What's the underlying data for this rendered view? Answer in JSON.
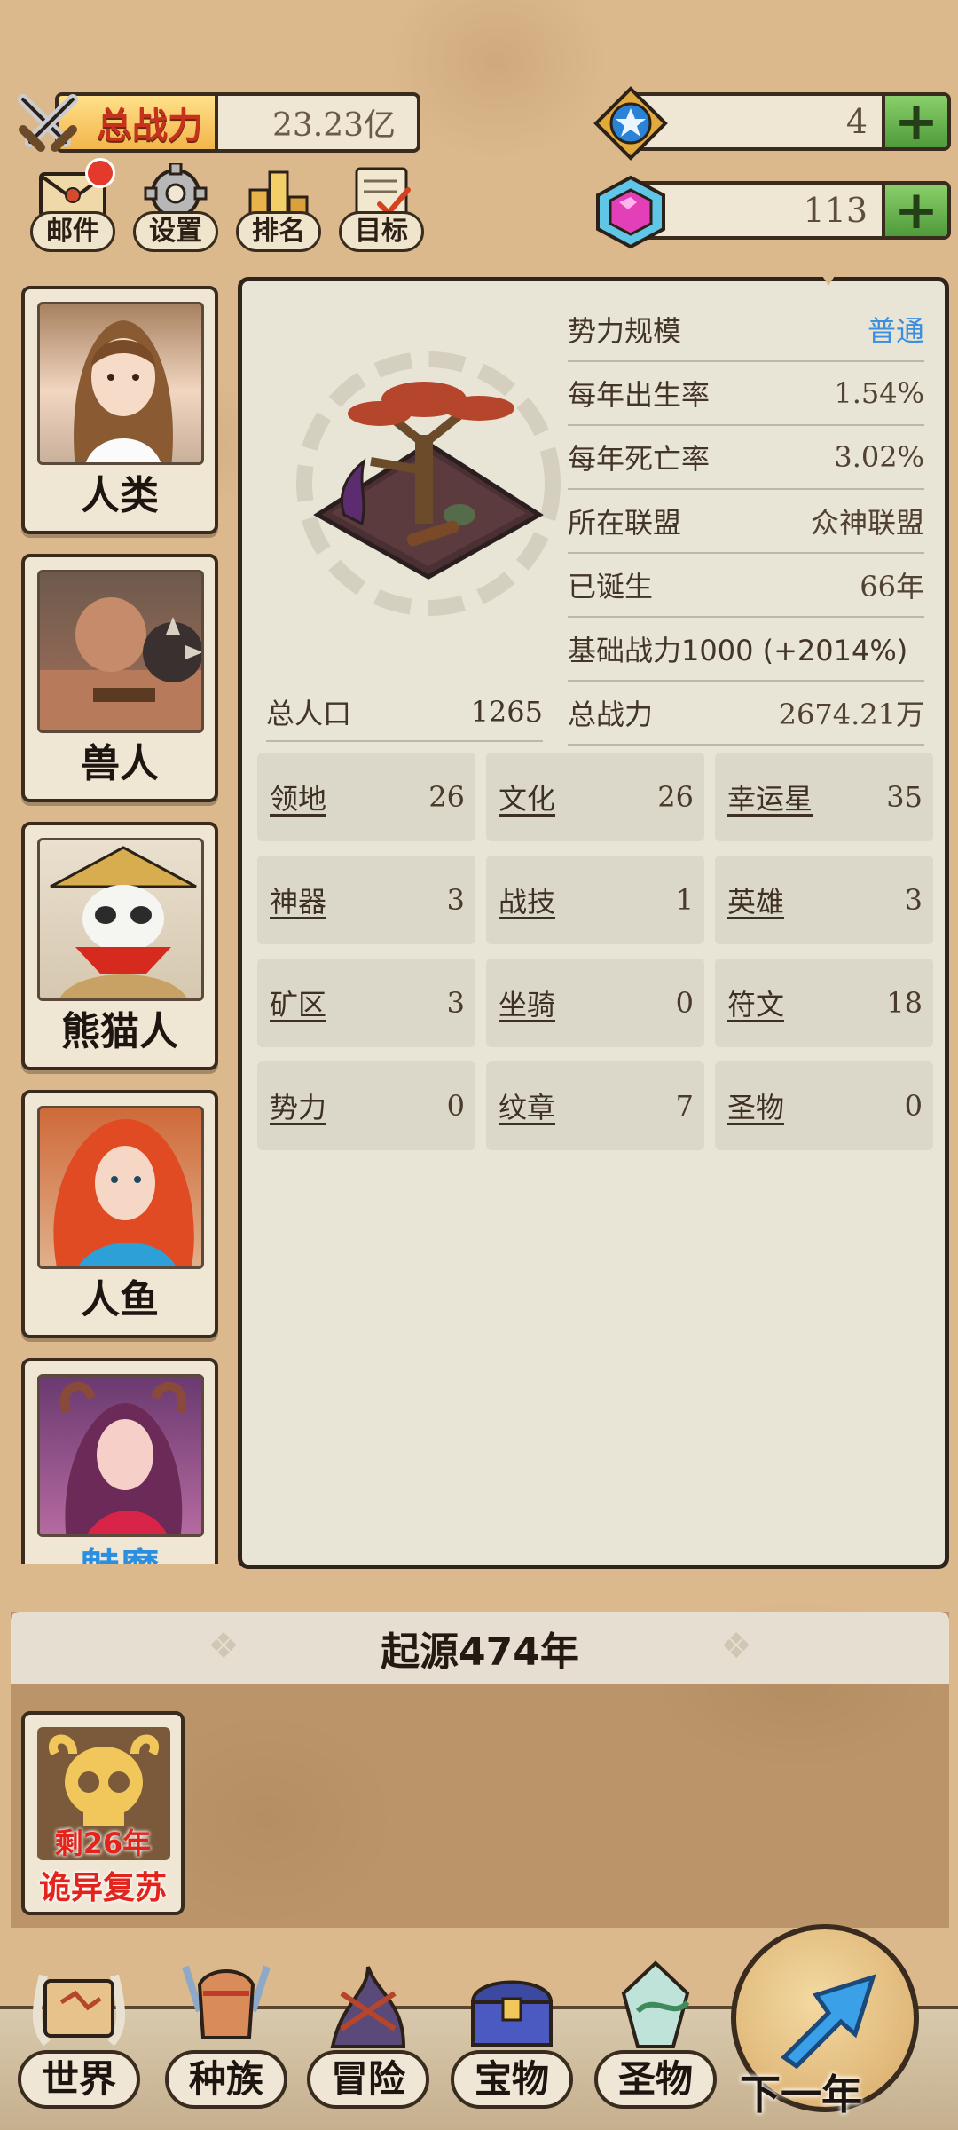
{
  "header": {
    "power_label": "总战力",
    "power_value": "23.23亿"
  },
  "currencies": [
    {
      "amount": "4",
      "plus": "+",
      "icon": "star-badge-icon"
    },
    {
      "amount": "113",
      "plus": "+",
      "icon": "pink-gem-icon"
    }
  ],
  "top_icons": [
    {
      "label": "邮件",
      "icon": "mail-icon",
      "badge": true
    },
    {
      "label": "设置",
      "icon": "gear-icon"
    },
    {
      "label": "排名",
      "icon": "ranking-icon"
    },
    {
      "label": "目标",
      "icon": "target-icon"
    }
  ],
  "races": [
    {
      "name": "人类"
    },
    {
      "name": "兽人"
    },
    {
      "name": "熊猫人"
    },
    {
      "name": "人鱼"
    },
    {
      "name": "魅魔"
    }
  ],
  "stats": [
    {
      "key": "势力规模",
      "value": "普通"
    },
    {
      "key": "每年出生率",
      "value": "1.54%"
    },
    {
      "key": "每年死亡率",
      "value": "3.02%"
    },
    {
      "key": "所在联盟",
      "value": "众神联盟"
    },
    {
      "key": "已诞生",
      "value": "66年"
    },
    {
      "key": "基础战力1000 (+2014%)",
      "value": ""
    },
    {
      "key": "总战力",
      "value": "2674.21万"
    }
  ],
  "population": {
    "key": "总人口",
    "value": "1265"
  },
  "grid": [
    {
      "key": "领地",
      "value": "26"
    },
    {
      "key": "文化",
      "value": "26"
    },
    {
      "key": "幸运星",
      "value": "35"
    },
    {
      "key": "神器",
      "value": "3"
    },
    {
      "key": "战技",
      "value": "1"
    },
    {
      "key": "英雄",
      "value": "3"
    },
    {
      "key": "矿区",
      "value": "3"
    },
    {
      "key": "坐骑",
      "value": "0"
    },
    {
      "key": "符文",
      "value": "18"
    },
    {
      "key": "势力",
      "value": "0"
    },
    {
      "key": "纹章",
      "value": "7"
    },
    {
      "key": "圣物",
      "value": "0"
    }
  ],
  "origin": {
    "title": "起源474年",
    "event": {
      "remain": "剩26年",
      "title": "诡异复苏"
    }
  },
  "nav": [
    {
      "label": "世界"
    },
    {
      "label": "种族"
    },
    {
      "label": "冒险"
    },
    {
      "label": "宝物"
    },
    {
      "label": "圣物"
    }
  ],
  "next_year": "下一年"
}
